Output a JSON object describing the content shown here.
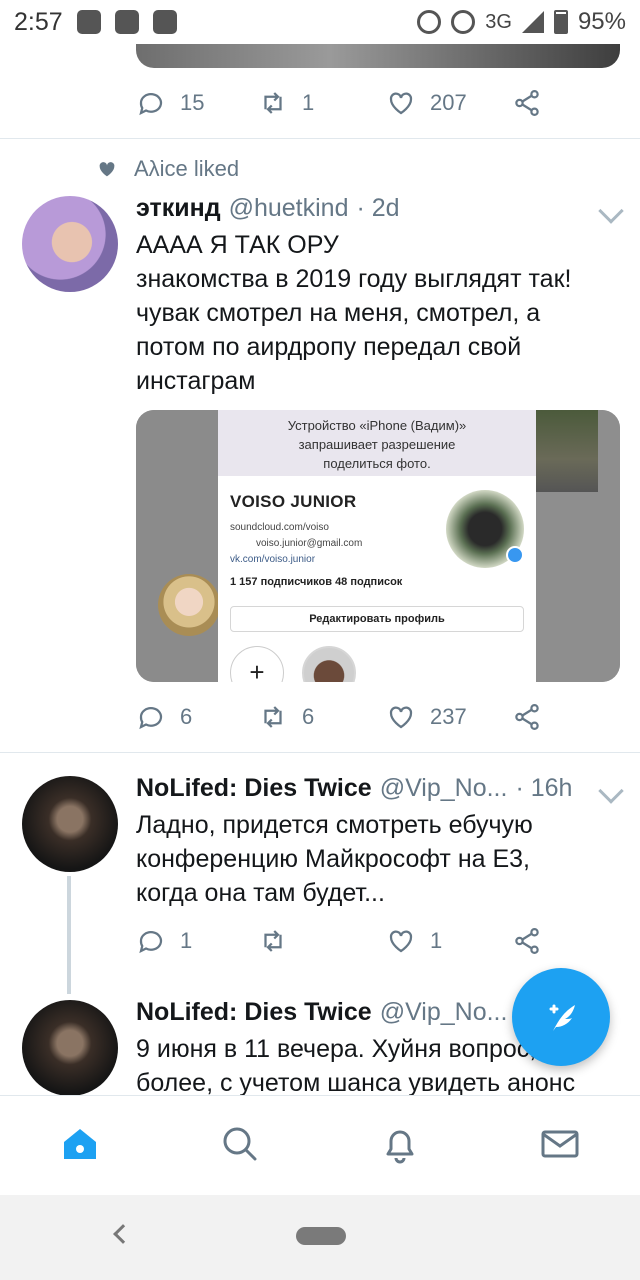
{
  "status_bar": {
    "time": "2:57",
    "network": "3G",
    "battery": "95%"
  },
  "prev_tweet": {
    "replies": "15",
    "retweets": "1",
    "likes": "207"
  },
  "liked_by": "Aλice liked",
  "tweets": [
    {
      "name": "эткинд",
      "handle": "@huetkind",
      "time": "· 2d",
      "lines": [
        "АААА Я ТАК ОРУ",
        "знакомства в 2019 году выглядят так!",
        "чувак смотрел на меня, смотрел, а",
        "потом по аирдропу передал свой",
        "инстаграм"
      ],
      "media": {
        "top_text_1": "Устройство «iPhone (Вадим)»",
        "top_text_2": "запрашивает разрешение",
        "top_text_3": "поделиться фото.",
        "profile_name": "VOISO JUNIOR",
        "link_1": "soundcloud.com/voiso",
        "link_2": "voiso.junior@gmail.com",
        "link_3": "vk.com/voiso.junior",
        "stats": "1 157 подписчиков   48 подписок",
        "edit_button": "Редактировать профиль",
        "story_add": "+"
      },
      "replies": "6",
      "retweets": "6",
      "likes": "237"
    },
    {
      "name": "NoLifed: Dies Twice",
      "handle": "@Vip_No...",
      "time": "· 16h",
      "lines": [
        "Ладно, придется смотреть ебучую",
        "конференцию Майкрософт на Е3,",
        "когда она там будет..."
      ],
      "replies": "1",
      "retweets": "",
      "likes": "1"
    },
    {
      "name": "NoLifed: Dies Twice",
      "handle": "@Vip_No...",
      "lines": [
        "9 июня в 11 вечера. Хуйня вопрос, тем",
        "более, с учетом шанса увидеть анонс"
      ]
    }
  ],
  "nav": {
    "items": [
      "home-icon",
      "search-icon",
      "bell-icon",
      "mail-icon"
    ]
  },
  "colors": {
    "accent": "#1da1f2",
    "muted": "#657786",
    "divider": "#e1e8ed"
  }
}
